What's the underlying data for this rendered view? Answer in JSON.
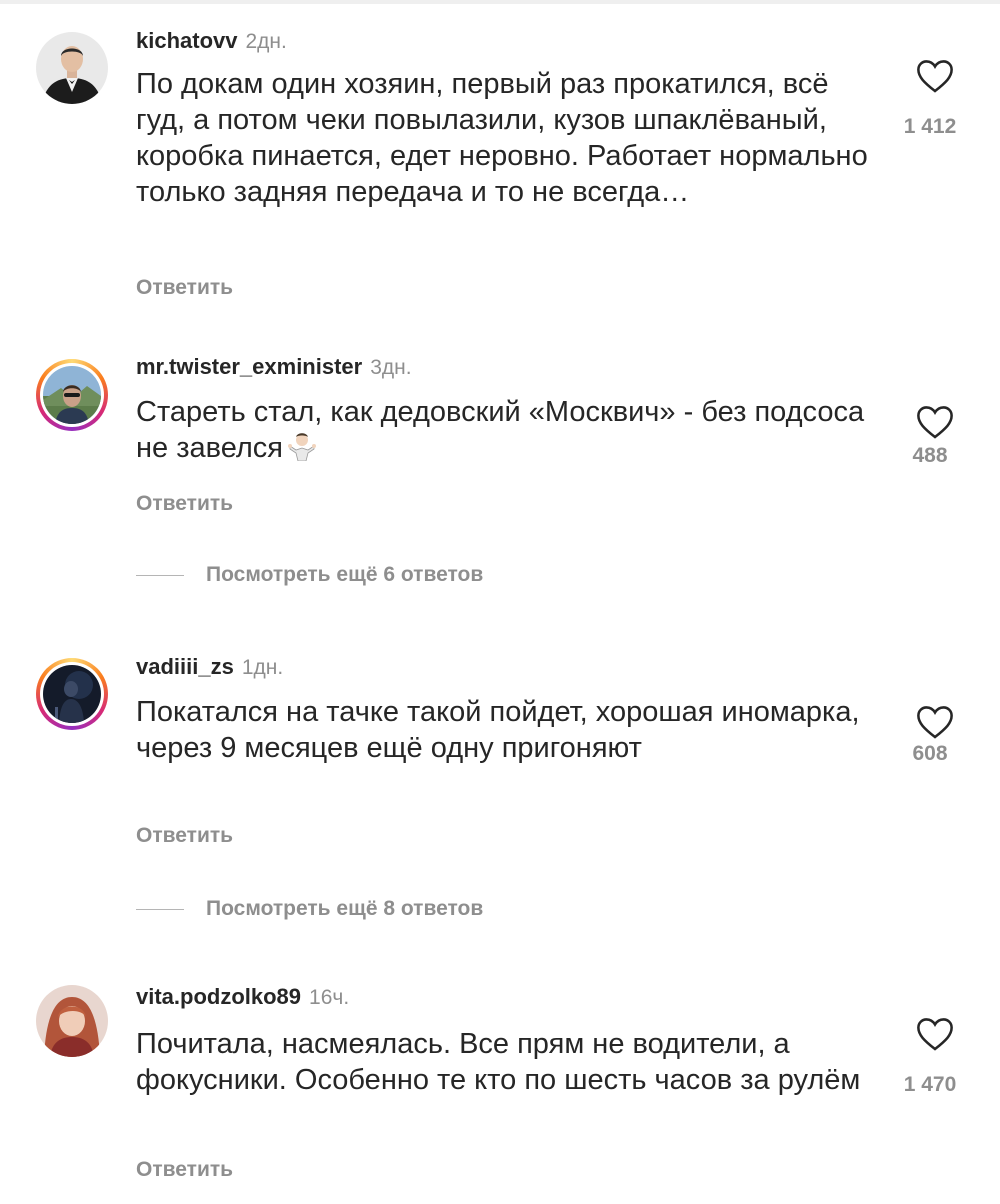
{
  "comments": [
    {
      "username": "kichatovv",
      "time": "2дн.",
      "text": "По докам один хозяин, первый раз прокатился, всё гуд, а потом чеки повылазили, кузов шпаклёваный, коробка пинается, едет неровно. Работает нормально только задняя передача и то не всегда…",
      "likes": "1 412",
      "reply_label": "Ответить",
      "avatar_icon": "avatar-man-in-suit",
      "has_story_ring": false
    },
    {
      "username": "mr.twister_exminister",
      "time": "3дн.",
      "text": "Стареть стал, как дедовский «Москвич» - без подсоса не завелся",
      "emoji": "shrug-emoji",
      "likes": "488",
      "reply_label": "Ответить",
      "view_more": "Посмотреть ещё 6 ответов",
      "avatar_icon": "avatar-man-outdoors",
      "has_story_ring": true
    },
    {
      "username": "vadiiii_zs",
      "time": "1дн.",
      "text": "Покатался на тачке такой пойдет, хорошая иномарка, через 9 месяцев ещё одну пригоняют",
      "likes": "608",
      "reply_label": "Ответить",
      "view_more": "Посмотреть ещё 8 ответов",
      "avatar_icon": "avatar-dark-figure",
      "has_story_ring": true
    },
    {
      "username": "vita.podzolko89",
      "time": "16ч.",
      "text": "Почитала, насмеялась. Все прям не водители, а фокусники. Особенно те кто по шесть часов за рулём",
      "likes": "1 470",
      "reply_label": "Ответить",
      "avatar_icon": "avatar-woman-red-hair",
      "has_story_ring": false
    }
  ],
  "colors": {
    "text": "#262626",
    "secondary": "#8e8e8e",
    "ring": [
      "#feda75",
      "#fa7e1e",
      "#d62976",
      "#962fbf"
    ]
  }
}
